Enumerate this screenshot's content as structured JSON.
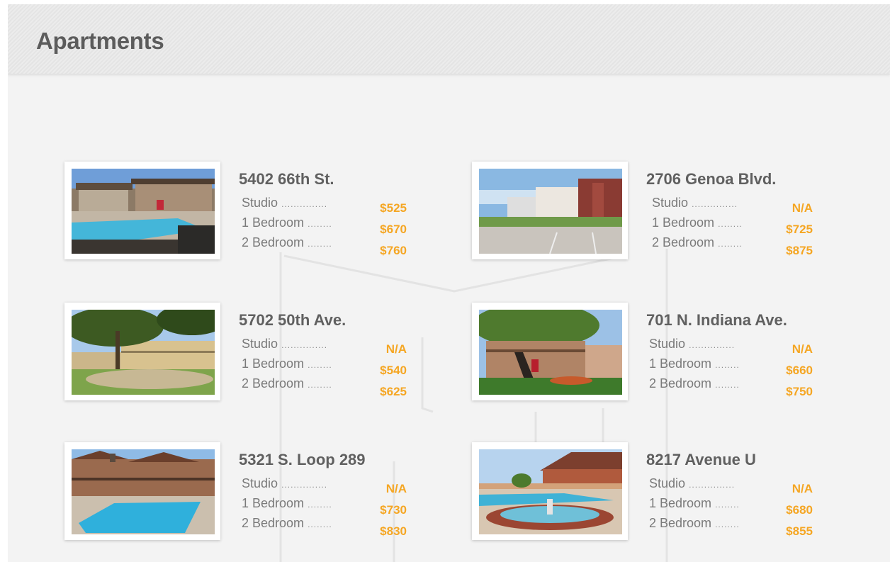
{
  "page_title": "Apartments",
  "colors": {
    "price": "#f5a623",
    "title": "#5c5c5c",
    "background": "#f3f3f3"
  },
  "listings": [
    {
      "address": "5402 66th St.",
      "units": [
        {
          "label": "Studio",
          "dots": "...............",
          "price": "$525"
        },
        {
          "label": "1 Bedroom",
          "dots": "........",
          "price": "$670"
        },
        {
          "label": "2 Bedroom",
          "dots": "........",
          "price": "$760"
        }
      ],
      "photo": "apartment-pool-photo"
    },
    {
      "address": "2706 Genoa Blvd.",
      "units": [
        {
          "label": "Studio",
          "dots": "...............",
          "price": "N/A"
        },
        {
          "label": "1 Bedroom",
          "dots": "........",
          "price": "$725"
        },
        {
          "label": "2 Bedroom",
          "dots": "........",
          "price": "$875"
        }
      ],
      "photo": "apartment-parking-lot-photo"
    },
    {
      "address": "5702 50th Ave.",
      "units": [
        {
          "label": "Studio",
          "dots": "...............",
          "price": "N/A"
        },
        {
          "label": "1 Bedroom",
          "dots": "........",
          "price": "$540"
        },
        {
          "label": "2 Bedroom",
          "dots": "........",
          "price": "$625"
        }
      ],
      "photo": "apartment-courtyard-tree-photo"
    },
    {
      "address": "701 N. Indiana Ave.",
      "units": [
        {
          "label": "Studio",
          "dots": "...............",
          "price": "N/A"
        },
        {
          "label": "1 Bedroom",
          "dots": "........",
          "price": "$660"
        },
        {
          "label": "2 Bedroom",
          "dots": "........",
          "price": "$750"
        }
      ],
      "photo": "apartment-staircase-photo"
    },
    {
      "address": "5321 S. Loop 289",
      "units": [
        {
          "label": "Studio",
          "dots": "...............",
          "price": "N/A"
        },
        {
          "label": "1 Bedroom",
          "dots": "........",
          "price": "$730"
        },
        {
          "label": "2 Bedroom",
          "dots": "........",
          "price": "$830"
        }
      ],
      "photo": "apartment-pool-photo"
    },
    {
      "address": "8217 Avenue U",
      "units": [
        {
          "label": "Studio",
          "dots": "...............",
          "price": "N/A"
        },
        {
          "label": "1 Bedroom",
          "dots": "........",
          "price": "$680"
        },
        {
          "label": "2 Bedroom",
          "dots": "........",
          "price": "$855"
        }
      ],
      "photo": "apartment-fountain-photo"
    }
  ]
}
